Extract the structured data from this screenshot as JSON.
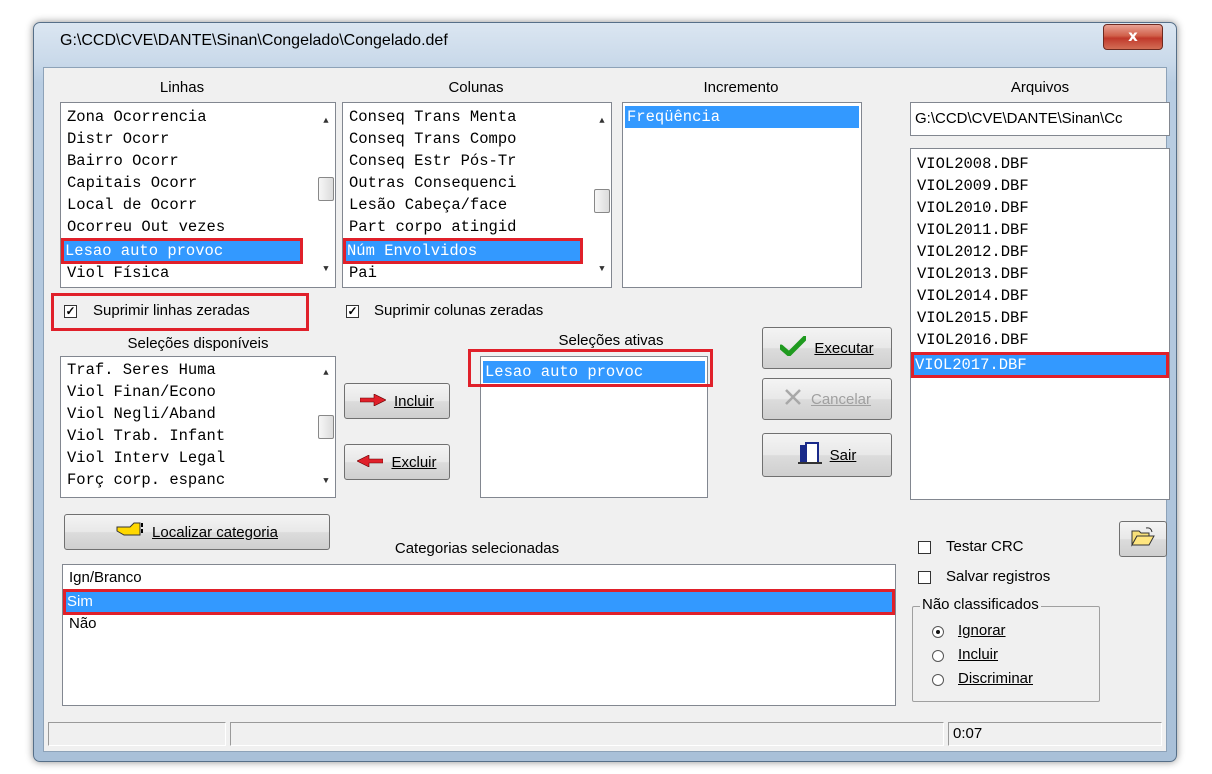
{
  "window": {
    "title": "G:\\CCD\\CVE\\DANTE\\Sinan\\Congelado\\Congelado.def",
    "close_label": "x"
  },
  "linhas": {
    "header": "Linhas",
    "items": [
      "Zona Ocorrencia",
      "Distr Ocorr",
      "Bairro Ocorr",
      "Capitais Ocorr",
      "Local de Ocorr",
      "Ocorreu Out vezes",
      "Lesao auto provoc",
      "Viol Física"
    ],
    "selected": "Lesao auto provoc"
  },
  "colunas": {
    "header": "Colunas",
    "items": [
      "Conseq Trans Menta",
      "Conseq Trans Compo",
      "Conseq Estr Pós-Tr",
      "Outras Consequenci",
      "Lesão Cabeça/face",
      "Part corpo atingid",
      "Núm Envolvidos",
      "Pai"
    ],
    "selected": "Núm Envolvidos"
  },
  "incremento": {
    "header": "Incremento",
    "items": [
      "Freqüência"
    ]
  },
  "arquivos": {
    "header": "Arquivos",
    "path": "G:\\CCD\\CVE\\DANTE\\Sinan\\Cc",
    "items": [
      "VIOL2008.DBF",
      "VIOL2009.DBF",
      "VIOL2010.DBF",
      "VIOL2011.DBF",
      "VIOL2012.DBF",
      "VIOL2013.DBF",
      "VIOL2014.DBF",
      "VIOL2015.DBF",
      "VIOL2016.DBF",
      "VIOL2017.DBF"
    ],
    "selected": "VIOL2017.DBF"
  },
  "checkboxes": {
    "suprimir_linhas": {
      "label": "Suprimir linhas zeradas",
      "checked": true
    },
    "suprimir_colunas": {
      "label": "Suprimir colunas zeradas",
      "checked": true
    },
    "testar_crc": {
      "label": "Testar CRC",
      "checked": false
    },
    "salvar_registros": {
      "label": "Salvar registros",
      "checked": false
    }
  },
  "selecoes_disponiveis": {
    "header": "Seleções disponíveis",
    "items": [
      "Traf. Seres Huma",
      "Viol Finan/Econo",
      "Viol Negli/Aband",
      "Viol Trab. Infant",
      "Viol Interv Legal",
      "Forç corp. espanc"
    ]
  },
  "selecoes_ativas": {
    "header": "Seleções ativas",
    "items": [
      "Lesao auto provoc"
    ]
  },
  "buttons": {
    "incluir": "Incluir",
    "excluir": "Excluir",
    "executar": "Executar",
    "cancelar": "Cancelar",
    "sair": "Sair",
    "localizar": "Localizar categoria"
  },
  "categorias": {
    "header": "Categorias selecionadas",
    "items": [
      "Ign/Branco",
      "Sim",
      "Não"
    ],
    "selected": "Sim"
  },
  "nao_classificados": {
    "legend": "Não classificados",
    "options": [
      {
        "label": "Ignorar",
        "checked": true
      },
      {
        "label": "Incluir",
        "checked": false
      },
      {
        "label": "Discriminar",
        "checked": false
      }
    ]
  },
  "status_bar": {
    "panel1": "",
    "panel2": "",
    "time": "0:07"
  },
  "colors": {
    "selection": "#3399ff",
    "highlight_box": "#e0202a"
  }
}
